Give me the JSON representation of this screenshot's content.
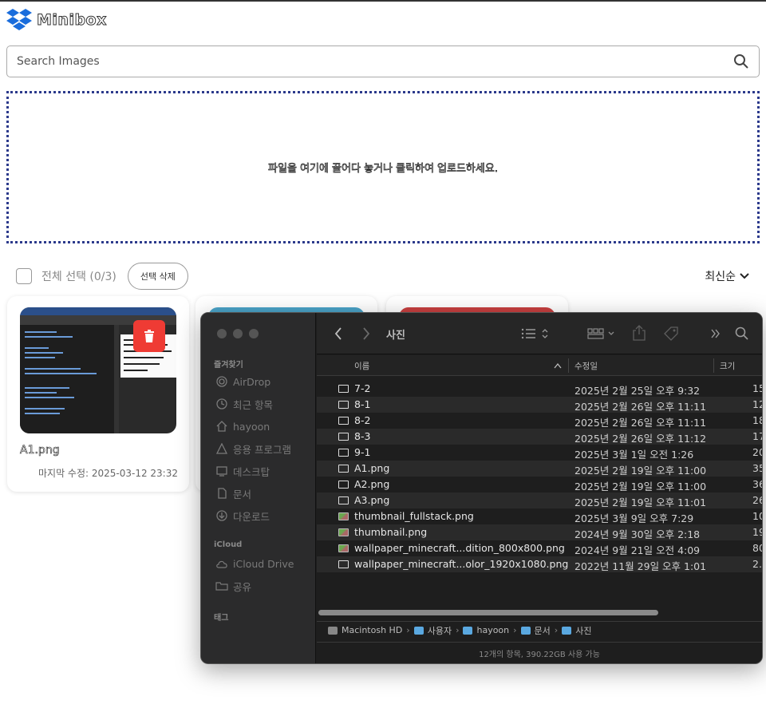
{
  "app": {
    "name": "Minibox",
    "search_placeholder": "Search Images",
    "dropzone_text": "파일을 여기에 끌어다 놓거나 클릭하여 업로드하세요.",
    "select_all_label": "전체 선택 (0/3)",
    "delete_selected_label": "선택 삭제",
    "sort_label": "최신순",
    "cards": [
      {
        "name": "A1.png",
        "modified": "마지막 수정: 2025-03-12 23:32"
      }
    ],
    "colors": {
      "accent": "#2c3a8c",
      "delete": "#ef3b34"
    }
  },
  "finder": {
    "title": "사진",
    "sidebar": {
      "favorites_label": "즐겨찾기",
      "favorites": [
        {
          "label": "AirDrop",
          "icon": "airdrop-icon"
        },
        {
          "label": "최근 항목",
          "icon": "clock-icon"
        },
        {
          "label": "hayoon",
          "icon": "home-icon"
        },
        {
          "label": "응용 프로그램",
          "icon": "apps-icon"
        },
        {
          "label": "데스크탑",
          "icon": "desktop-icon"
        },
        {
          "label": "문서",
          "icon": "document-icon"
        },
        {
          "label": "다운로드",
          "icon": "download-icon"
        }
      ],
      "icloud_label": "iCloud",
      "icloud": [
        {
          "label": "iCloud Drive",
          "icon": "cloud-icon"
        },
        {
          "label": "공유",
          "icon": "shared-folder-icon"
        }
      ],
      "tags_label": "태그"
    },
    "columns": {
      "name": "이름",
      "date": "수정일",
      "size": "크기"
    },
    "files": [
      {
        "name": "7-2",
        "date": "2025년 2월 25일 오후 9:32",
        "size": "15"
      },
      {
        "name": "8-1",
        "date": "2025년 2월 26일 오후 11:11",
        "size": "12"
      },
      {
        "name": "8-2",
        "date": "2025년 2월 26일 오후 11:11",
        "size": "18"
      },
      {
        "name": "8-3",
        "date": "2025년 2월 26일 오후 11:12",
        "size": "17"
      },
      {
        "name": "9-1",
        "date": "2025년 3월 1일 오전 1:26",
        "size": "20"
      },
      {
        "name": "A1.png",
        "date": "2025년 2월 19일 오후 11:00",
        "size": "35"
      },
      {
        "name": "A2.png",
        "date": "2025년 2월 19일 오후 11:00",
        "size": "36"
      },
      {
        "name": "A3.png",
        "date": "2025년 2월 19일 오후 11:01",
        "size": "26"
      },
      {
        "name": "thumbnail_fullstack.png",
        "date": "2025년 3월 9일 오후 7:29",
        "size": "10"
      },
      {
        "name": "thumbnail.png",
        "date": "2024년 9월 30일 오후 2:18",
        "size": "19"
      },
      {
        "name": "wallpaper_minecraft...dition_800x800.png",
        "date": "2024년 9월 21일 오전 4:09",
        "size": "80"
      },
      {
        "name": "wallpaper_minecraft...olor_1920x1080.png",
        "date": "2022년 11월 29일 오후 1:01",
        "size": "2."
      }
    ],
    "path": [
      "Macintosh HD",
      "사용자",
      "hayoon",
      "문서",
      "사진"
    ],
    "status": "12개의 항목, 390.22GB 사용 가능"
  }
}
